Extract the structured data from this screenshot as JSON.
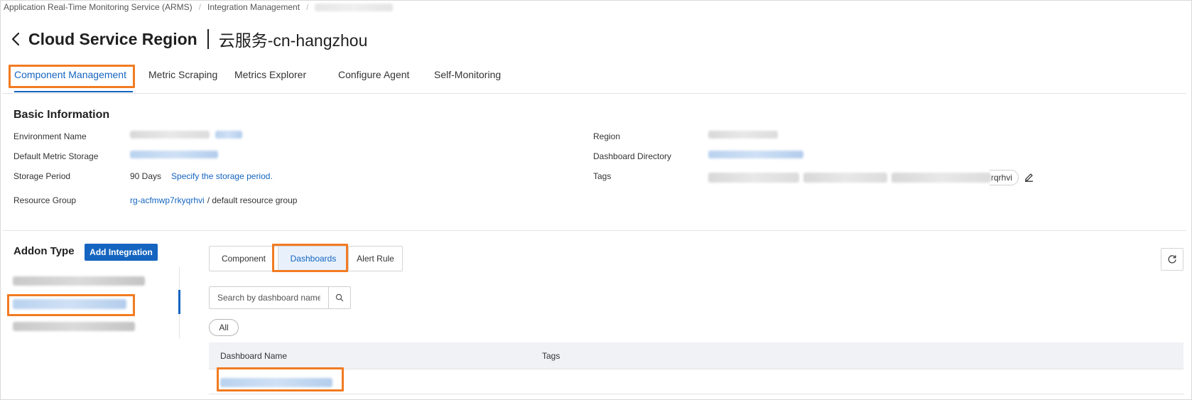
{
  "breadcrumb": {
    "items": [
      "Application Real-Time Monitoring Service (ARMS)",
      "Integration Management"
    ],
    "separator": "/"
  },
  "header": {
    "title": "Cloud Service Region",
    "subtitle": "云服务-cn-hangzhou"
  },
  "tabs": [
    {
      "label": "Component Management",
      "active": true
    },
    {
      "label": "Metric Scraping",
      "active": false
    },
    {
      "label": "Metrics Explorer",
      "active": false
    },
    {
      "label": "Configure Agent",
      "active": false
    },
    {
      "label": "Self-Monitoring",
      "active": false
    }
  ],
  "basic_info": {
    "title": "Basic Information",
    "environment_name_label": "Environment Name",
    "default_metric_storage_label": "Default Metric Storage",
    "storage_period_label": "Storage Period",
    "storage_period_value": "90 Days",
    "storage_period_link": "Specify the storage period.",
    "resource_group_label": "Resource Group",
    "resource_group_id": "rg-acfmwp7rkyqrhvi",
    "resource_group_suffix": "/ default resource group",
    "region_label": "Region",
    "dashboard_directory_label": "Dashboard Directory",
    "tags_label": "Tags",
    "tag_visible_suffix": "rqrhvi"
  },
  "addon": {
    "title": "Addon Type",
    "add_button": "Add Integration"
  },
  "segmented": [
    {
      "label": "Component",
      "active": false
    },
    {
      "label": "Dashboards",
      "active": true
    },
    {
      "label": "Alert Rule",
      "active": false
    }
  ],
  "search": {
    "placeholder": "Search by dashboard name"
  },
  "filter": {
    "all_label": "All"
  },
  "table": {
    "columns": [
      "Dashboard Name",
      "Tags"
    ]
  },
  "colors": {
    "accent": "#1565c0",
    "highlight": "#f27b22"
  },
  "icons": [
    "chevron-left-icon",
    "edit-icon",
    "refresh-icon",
    "search-icon"
  ]
}
